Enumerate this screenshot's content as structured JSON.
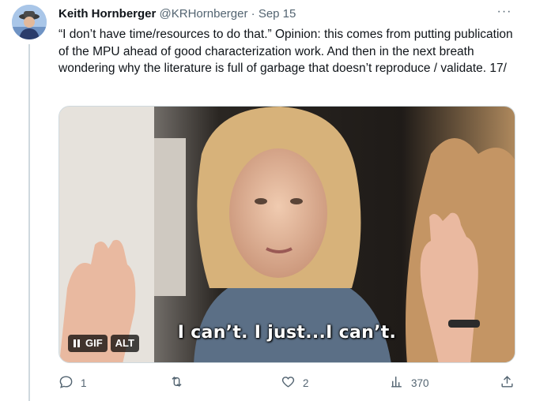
{
  "tweet": {
    "author_name": "Keith Hornberger",
    "author_handle": "@KRHornberger",
    "separator": "·",
    "date": "Sep 15",
    "more": "···",
    "text": "“I don’t have time/resources to do that.” Opinion: this comes from putting publication of the MPU ahead of good characterization work. And then in the next breath wondering why the literature is full of garbage that doesn’t reproduce / validate. 17/"
  },
  "media": {
    "type": "GIF",
    "caption": "I can’t. I just...I can’t.",
    "pause_icon": "pause-icon",
    "gif_label": "GIF",
    "alt_label": "ALT"
  },
  "actions": {
    "reply_count": "1",
    "retweet_count": "",
    "like_count": "2",
    "views_count": "370",
    "icons": [
      "reply-icon",
      "retweet-icon",
      "like-icon",
      "views-icon",
      "share-icon"
    ]
  },
  "colors": {
    "secondary_text": "#536471",
    "thread_line": "#cfd9de"
  }
}
